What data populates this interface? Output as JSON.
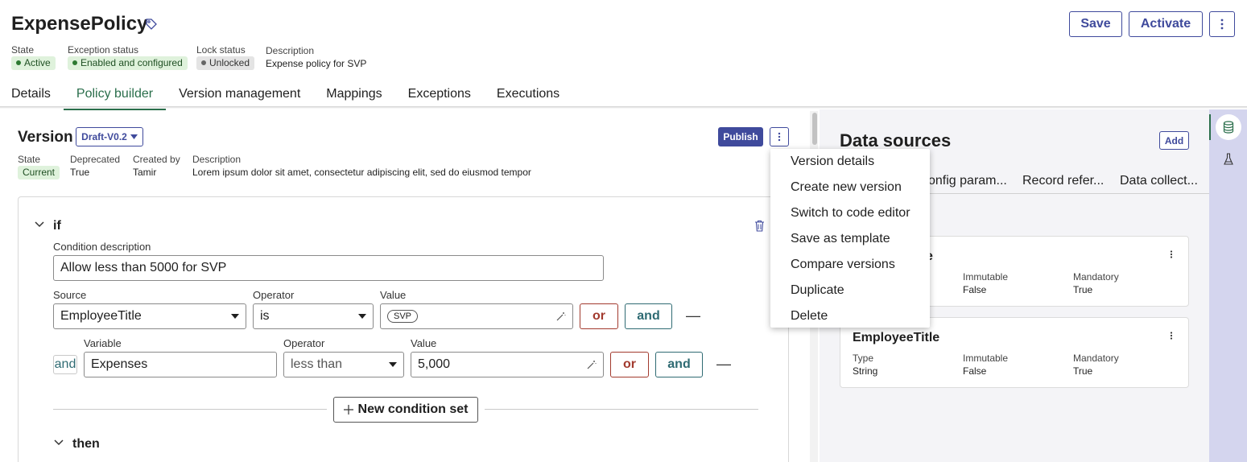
{
  "header": {
    "title": "ExpensePolicy",
    "save_label": "Save",
    "activate_label": "Activate",
    "meta": {
      "state_label": "State",
      "state_value": "Active",
      "exception_label": "Exception status",
      "exception_value": "Enabled and configured",
      "lock_label": "Lock status",
      "lock_value": "Unlocked",
      "description_label": "Description",
      "description_value": "Expense policy for SVP"
    }
  },
  "tabs": [
    {
      "label": "Details",
      "active": false
    },
    {
      "label": "Policy builder",
      "active": true
    },
    {
      "label": "Version management",
      "active": false
    },
    {
      "label": "Mappings",
      "active": false
    },
    {
      "label": "Exceptions",
      "active": false
    },
    {
      "label": "Executions",
      "active": false
    }
  ],
  "version": {
    "title": "Version",
    "selected": "Draft-V0.2",
    "publish_label": "Publish",
    "state_label": "State",
    "state_value": "Current",
    "deprecated_label": "Deprecated",
    "deprecated_value": "True",
    "created_label": "Created by",
    "created_value": "Tamir",
    "description_label": "Description",
    "description_value": "Lorem ipsum dolor sit amet, consectetur adipiscing elit, sed do eiusmod tempor"
  },
  "builder": {
    "if_label": "if",
    "condition_description_label": "Condition description",
    "condition_description_value": "Allow less than 5000 for SVP",
    "row1": {
      "source_label": "Source",
      "source_value": "EmployeeTitle",
      "operator_label": "Operator",
      "operator_value": "is",
      "value_label": "Value",
      "value_chip": "SVP",
      "or_label": "or",
      "and_label": "and",
      "remove": "—"
    },
    "row2": {
      "connector": "and",
      "variable_label": "Variable",
      "variable_value": "Expenses",
      "operator_label": "Operator",
      "operator_value": "less than",
      "value_label": "Value",
      "value_value": "5,000",
      "or_label": "or",
      "and_label": "and",
      "remove": "—"
    },
    "new_condition_label": "New condition set",
    "then_label": "then"
  },
  "menu": {
    "items": [
      "Version details",
      "Create new version",
      "Switch to code editor",
      "Save as template",
      "Compare versions",
      "Duplicate",
      "Delete"
    ]
  },
  "data_sources": {
    "title": "Data sources",
    "add_label": "Add",
    "tabs": [
      "onfig param...",
      "Record refer...",
      "Data collect..."
    ],
    "cards": [
      {
        "title": "e",
        "type_label": "",
        "type_value": "",
        "immutable_label": "Immutable",
        "immutable_value": "False",
        "mandatory_label": "Mandatory",
        "mandatory_value": "True"
      },
      {
        "title": "EmployeeTitle",
        "type_label": "Type",
        "type_value": "String",
        "immutable_label": "Immutable",
        "immutable_value": "False",
        "mandatory_label": "Mandatory",
        "mandatory_value": "True"
      }
    ]
  },
  "rail": {
    "icons": [
      "database-icon",
      "flask-icon"
    ]
  },
  "colors": {
    "accent": "#3f4a9c",
    "active_tab": "#2a6e4b",
    "or_color": "#a23a2e",
    "and_color": "#2f6b73",
    "rail_bg": "#d4d5ee"
  }
}
